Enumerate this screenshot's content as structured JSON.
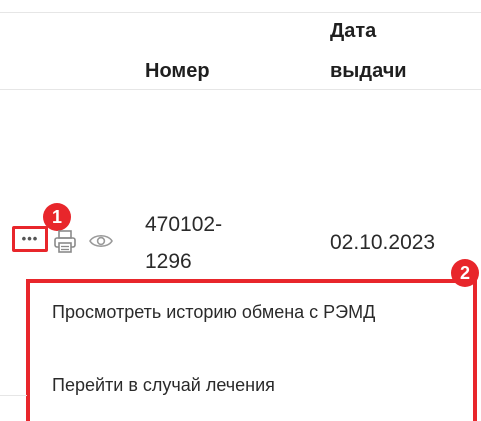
{
  "table": {
    "columns": {
      "number": "Номер",
      "date_line1": "Дата",
      "date_line2": "выдачи"
    },
    "row": {
      "number_line1": "470102-",
      "number_line2": "1296",
      "date": "02.10.2023"
    }
  },
  "annotations": {
    "marker_1": "1",
    "marker_2": "2"
  },
  "context_menu": {
    "items": [
      "Просмотреть историю обмена с РЭМД",
      "Перейти в случай лечения"
    ]
  },
  "colors": {
    "highlight": "#e8262b",
    "divider": "#e6e6e6"
  },
  "icons": [
    "more-icon",
    "printer-icon",
    "eye-icon"
  ]
}
